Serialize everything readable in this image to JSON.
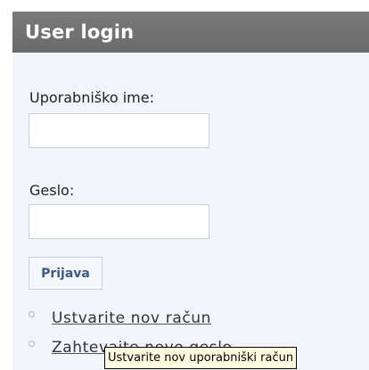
{
  "login_block": {
    "title": "User login",
    "username_label": "Uporabniško ime:",
    "username_value": "",
    "password_label": "Geslo:",
    "password_value": "",
    "submit_label": "Prijava",
    "links": [
      {
        "label": "Ustvarite nov račun"
      },
      {
        "label": "Zahtevajte novo geslo"
      }
    ]
  },
  "tooltip": {
    "text": "Ustvarite nov uporabniški račun"
  },
  "colors": {
    "header_background": "#6f6f6f",
    "block_background": "#f2f5f9",
    "button_text": "#3b5a86",
    "tooltip_background": "#ffffe1"
  }
}
